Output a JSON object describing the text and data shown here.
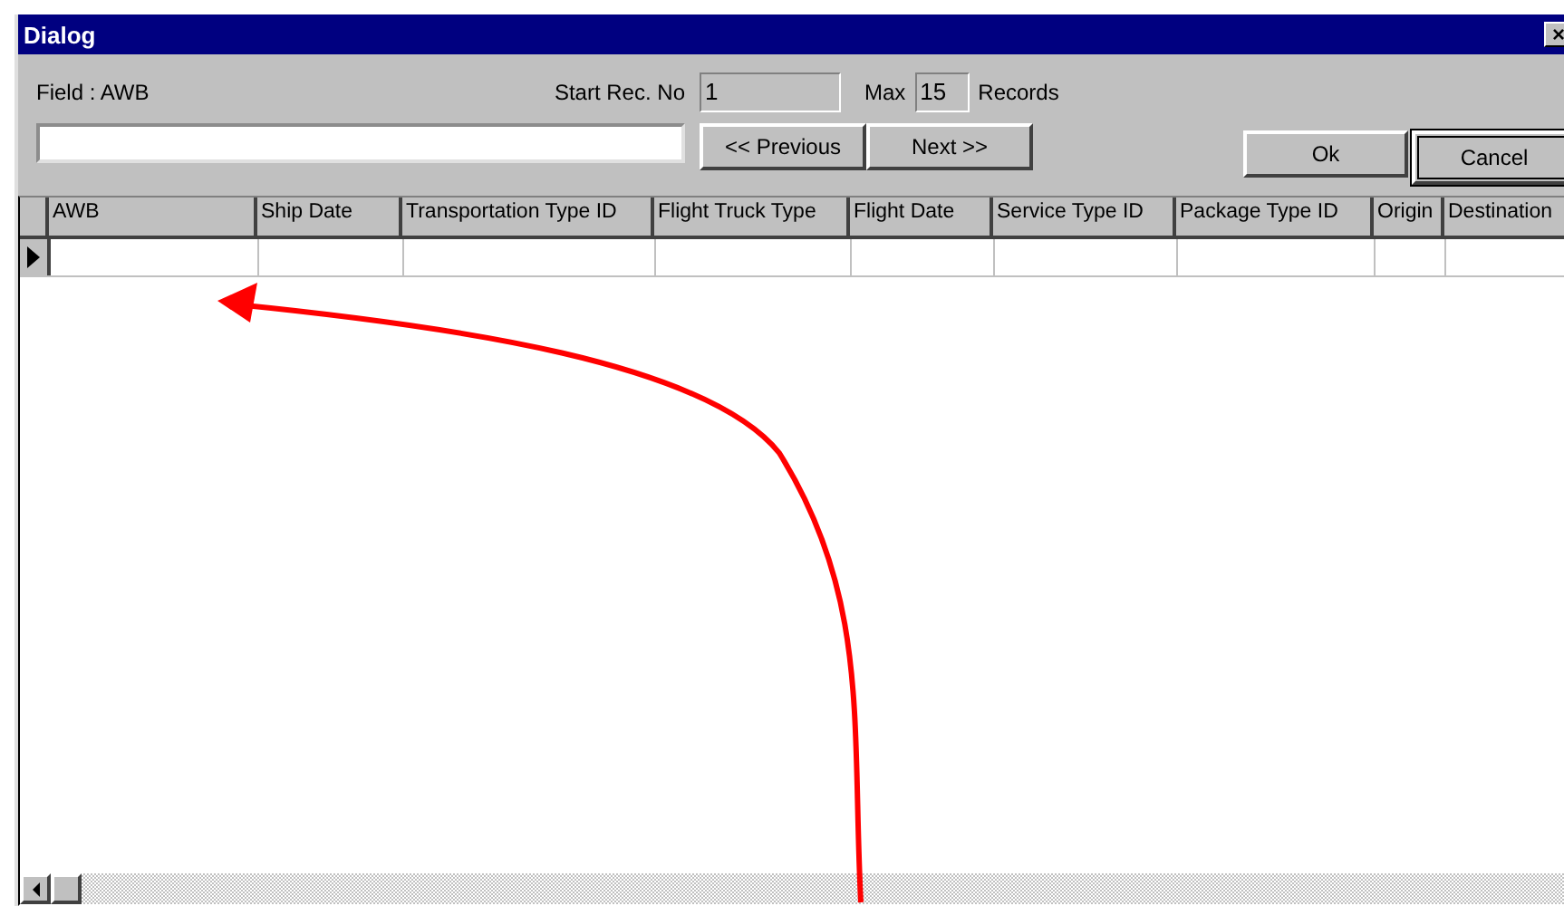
{
  "window": {
    "title": "Dialog",
    "close": "×"
  },
  "field_label": "Field : AWB",
  "start_rec": {
    "label": "Start Rec. No",
    "value": "1"
  },
  "max": {
    "label": "Max",
    "value": "15",
    "suffix": "Records"
  },
  "buttons": [
    {
      "label": "<< Previous",
      "kind": "nav"
    },
    {
      "label": "Next >>",
      "kind": "nav"
    },
    {
      "label": "Ok",
      "kind": "action",
      "focused": false
    },
    {
      "label": "Cancel",
      "kind": "action",
      "focused": true
    }
  ],
  "table": {
    "columns": [
      "AWB",
      "Ship Date",
      "Transportation Type ID",
      "Flight Truck Type",
      "Flight Date",
      "Service Type ID",
      "Package Type ID",
      "Origin",
      "Destination"
    ],
    "rows": [
      {
        "current": true
      }
    ]
  }
}
